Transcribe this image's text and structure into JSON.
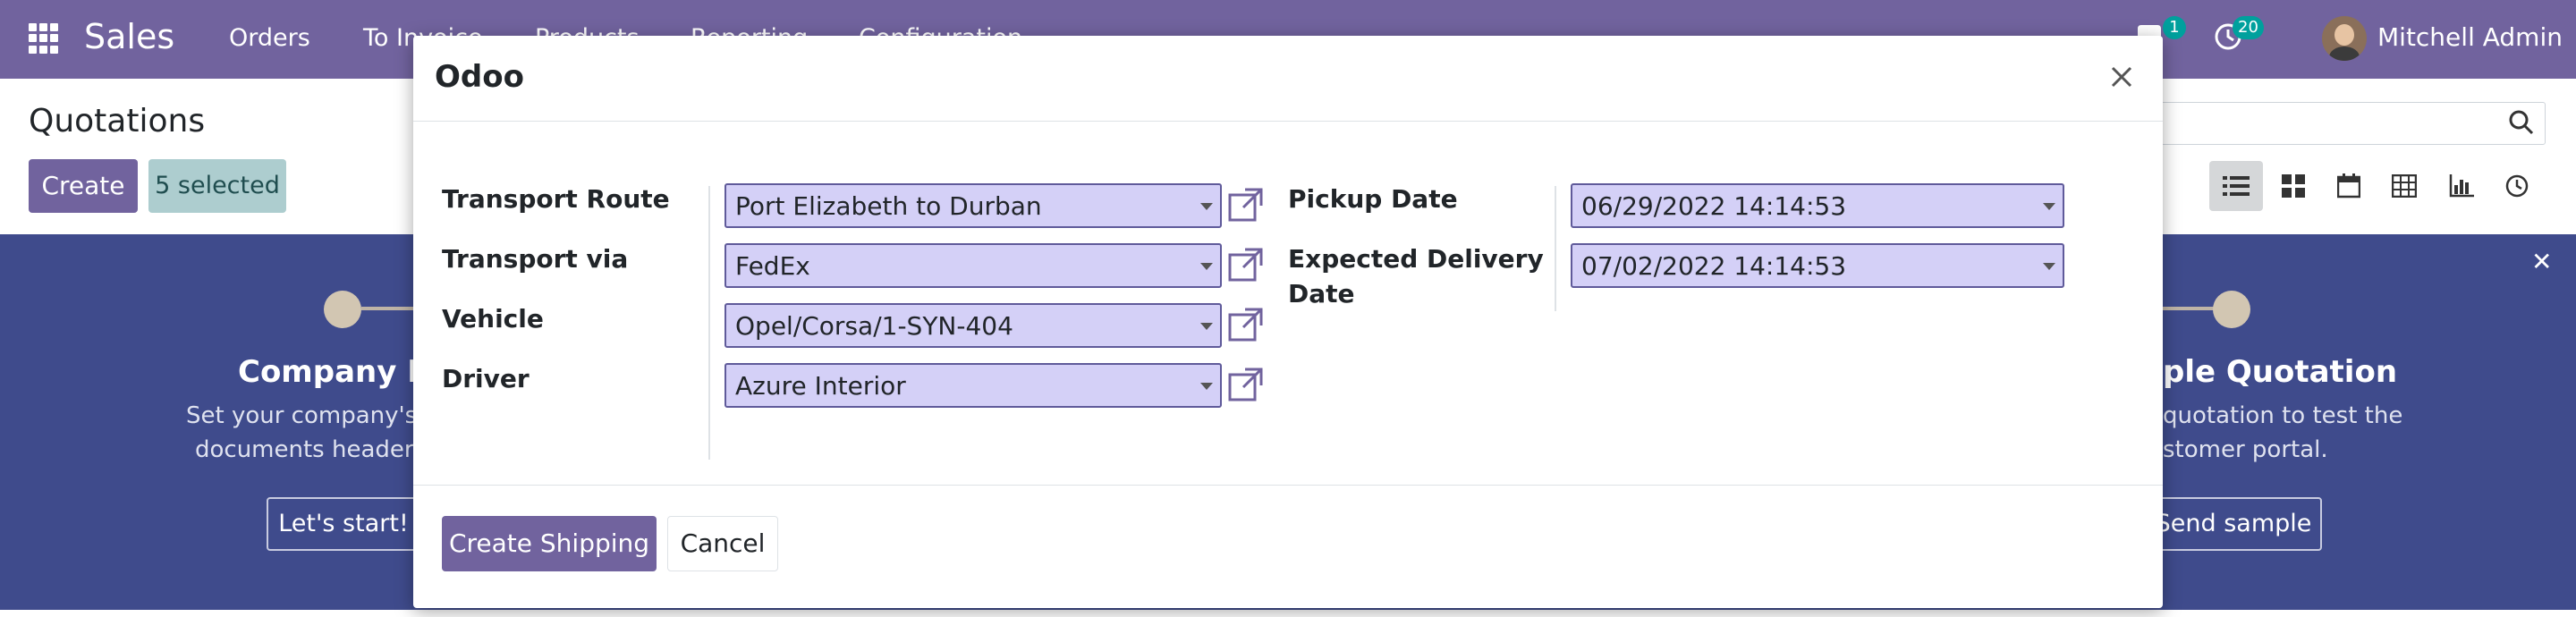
{
  "navbar": {
    "app_name": "Sales",
    "menu": [
      "Orders",
      "To Invoice",
      "Products",
      "Reporting",
      "Configuration"
    ],
    "messages_count": "1",
    "activities_count": "20",
    "user_name": "Mitchell Admin"
  },
  "control_panel": {
    "title": "Quotations",
    "create_label": "Create",
    "selected_label": "5 selected",
    "views": [
      "list-view-icon",
      "kanban-view-icon",
      "calendar-view-icon",
      "pivot-view-icon",
      "graph-view-icon",
      "activity-view-icon"
    ]
  },
  "banner": {
    "left_title": "Company Da",
    "left_text_1": "Set your company's",
    "left_text_2": "documents header/",
    "left_button": "Let's start!",
    "right_title": "ple Quotation",
    "right_text_1": "quotation to test the",
    "right_text_2": "stomer portal.",
    "right_button": "Send sample"
  },
  "modal": {
    "title": "Odoo",
    "fields_left": [
      {
        "label": "Transport Route",
        "value": "Port Elizabeth to Durban"
      },
      {
        "label": "Transport via",
        "value": "FedEx"
      },
      {
        "label": "Vehicle",
        "value": "Opel/Corsa/1-SYN-404"
      },
      {
        "label": "Driver",
        "value": "Azure Interior"
      }
    ],
    "fields_right": [
      {
        "label": "Pickup Date",
        "value": "06/29/2022 14:14:53"
      },
      {
        "label_line1": "Expected Delivery",
        "label_line2": "Date",
        "value": "07/02/2022 14:14:53"
      }
    ],
    "primary_button": "Create Shipping",
    "cancel_button": "Cancel"
  },
  "colors": {
    "brand": "#71639e",
    "banner": "#3f4b8c",
    "input_bg": "#d4d0f7",
    "badge": "#00a09d"
  }
}
